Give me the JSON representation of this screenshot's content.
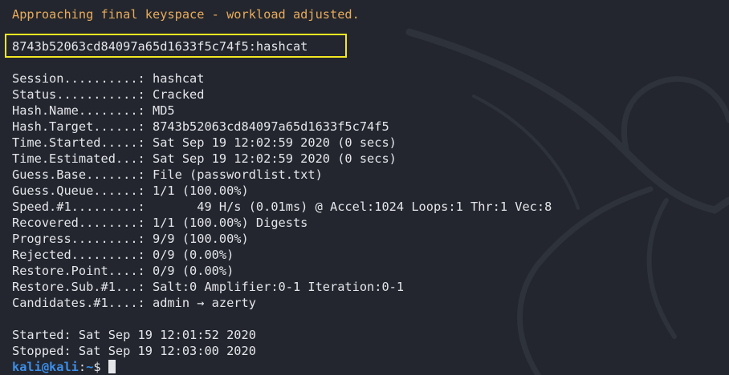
{
  "warning": "Approaching final keyspace - workload adjusted.",
  "cracked_result": "8743b52063cd84097a65d1633f5c74f5:hashcat",
  "status_lines": [
    "Session..........: hashcat",
    "Status...........: Cracked",
    "Hash.Name........: MD5",
    "Hash.Target......: 8743b52063cd84097a65d1633f5c74f5",
    "Time.Started.....: Sat Sep 19 12:02:59 2020 (0 secs)",
    "Time.Estimated...: Sat Sep 19 12:02:59 2020 (0 secs)",
    "Guess.Base.......: File (passwordlist.txt)",
    "Guess.Queue......: 1/1 (100.00%)",
    "Speed.#1.........:       49 H/s (0.01ms) @ Accel:1024 Loops:1 Thr:1 Vec:8",
    "Recovered........: 1/1 (100.00%) Digests",
    "Progress.........: 9/9 (100.00%)",
    "Rejected.........: 0/9 (0.00%)",
    "Restore.Point....: 0/9 (0.00%)",
    "Restore.Sub.#1...: Salt:0 Amplifier:0-1 Iteration:0-1",
    "Candidates.#1....: admin → azerty"
  ],
  "started": "Started: Sat Sep 19 12:01:52 2020",
  "stopped": "Stopped: Sat Sep 19 12:03:00 2020",
  "prompt": {
    "user_host": "kali@kali",
    "colon": ":",
    "path": "~",
    "sign": "$"
  },
  "colors": {
    "background": "#23262e",
    "text": "#e4e6ea",
    "warning": "#e8ab5b",
    "highlight_box": "#f4e821",
    "prompt": "#3b8eea"
  },
  "icons": {
    "watermark": "kali-dragon-icon"
  }
}
